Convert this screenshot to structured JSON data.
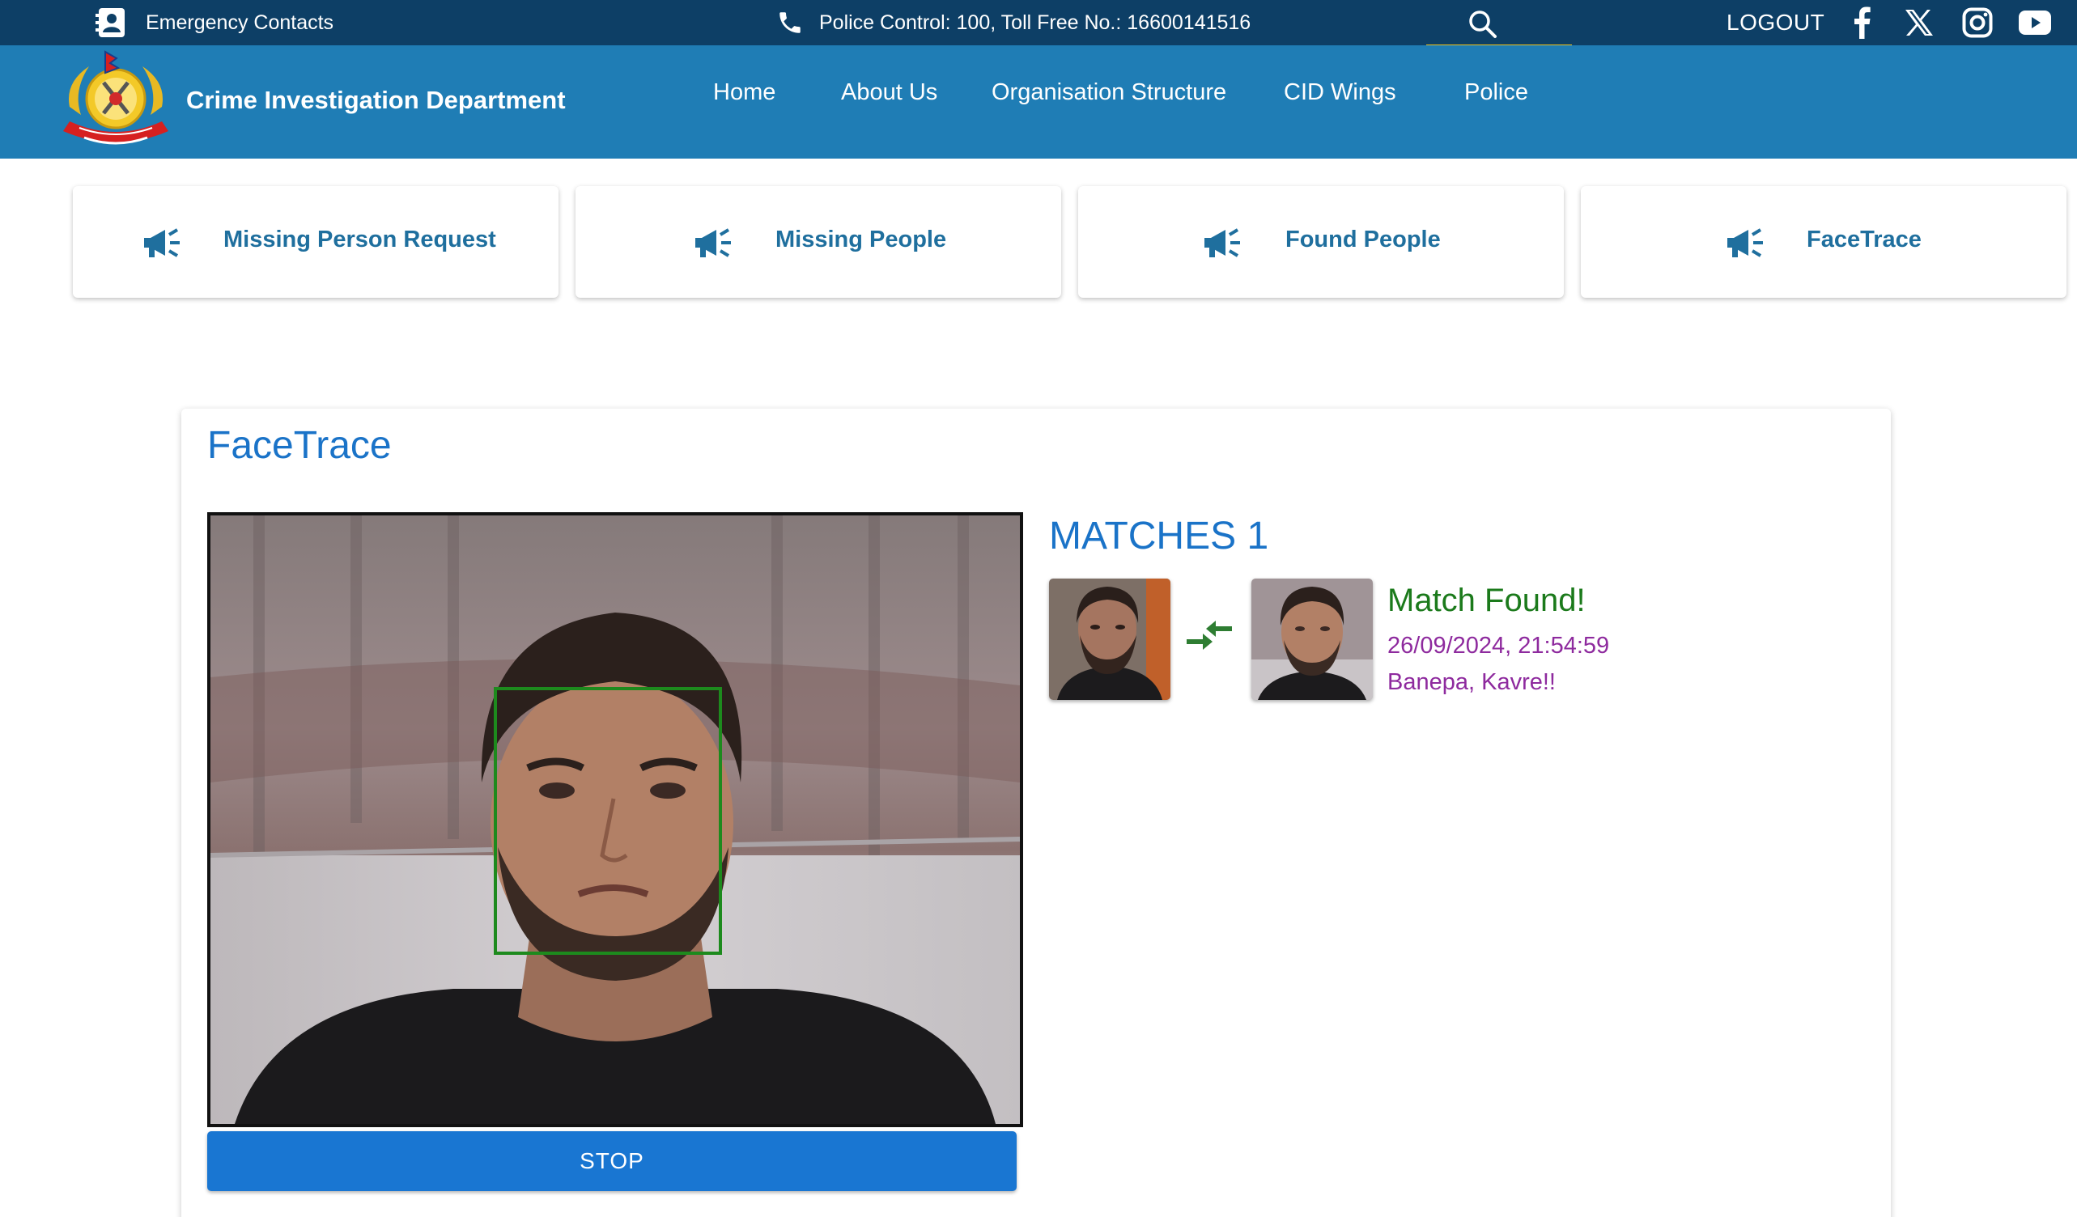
{
  "topbar": {
    "emergency_label": "Emergency Contacts",
    "phone_text": "Police Control: 100, Toll Free No.: 16600141516",
    "logout_label": "LOGOUT",
    "social_icons": [
      "facebook-icon",
      "x-icon",
      "instagram-icon",
      "youtube-icon"
    ]
  },
  "nav": {
    "site_title": "Crime Investigation Department",
    "links": [
      "Home",
      "About Us",
      "Organisation Structure",
      "CID Wings",
      "Police"
    ]
  },
  "quick_links": [
    {
      "label": "Missing Person Request",
      "icon": "megaphone-icon"
    },
    {
      "label": "Missing People",
      "icon": "megaphone-icon"
    },
    {
      "label": "Found People",
      "icon": "megaphone-icon"
    },
    {
      "label": "FaceTrace",
      "icon": "megaphone-icon"
    }
  ],
  "facetrace": {
    "title": "FaceTrace",
    "stop_label": "STOP",
    "matches_label": "MATCHES 1",
    "match": {
      "status": "Match Found!",
      "timestamp": "26/09/2024, 21:54:59",
      "location": "Banepa, Kavre!!"
    }
  },
  "colors": {
    "topbar": "#0d3f66",
    "nav": "#1f7db5",
    "accent": "#f2c31a",
    "primary": "#1976d2",
    "match_green": "#1b7a1b",
    "match_purple": "#8e2a9e"
  }
}
